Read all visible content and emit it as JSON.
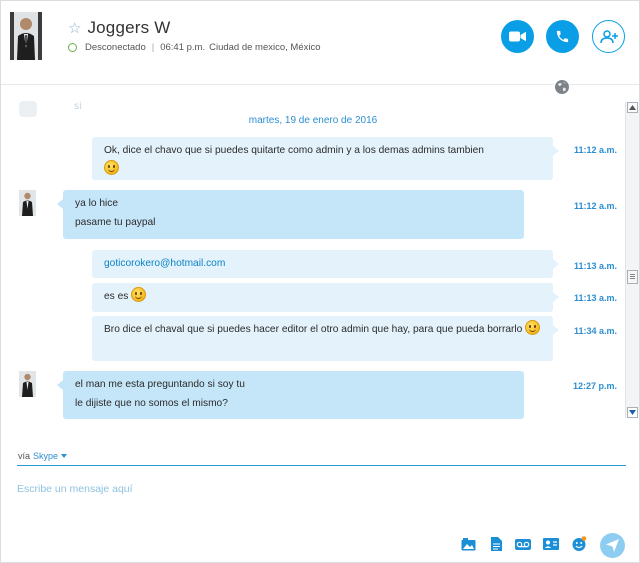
{
  "contact": {
    "name": "Joggers W",
    "status": "Desconectado",
    "local_time": "06:41 p.m.",
    "location": "Ciudad de mexico, México"
  },
  "colors": {
    "accent": "#0a9ee6",
    "bubble_sent": "#e3f2fb",
    "bubble_received": "#c5e6f9",
    "time": "#2d8fd0"
  },
  "header_buttons": [
    {
      "name": "video-call-button",
      "icon": "video-camera-icon"
    },
    {
      "name": "voice-call-button",
      "icon": "phone-icon"
    },
    {
      "name": "add-participant-button",
      "icon": "add-person-icon"
    }
  ],
  "conversation": {
    "ghost_text": "si",
    "date": "martes, 19 de enero de 2016",
    "messages": [
      {
        "from": "me",
        "text": "Ok, dice el chavo que si puedes quitarte como admin y a los demas admins tambien",
        "emoji": "smile",
        "time": "11:12 a.m."
      },
      {
        "from": "them",
        "text": "ya lo hice",
        "time": "11:12 a.m."
      },
      {
        "from": "them",
        "text": "pasame tu paypal"
      },
      {
        "from": "me",
        "text": "goticorokero@hotmail.com",
        "link": true,
        "time": "11:13 a.m."
      },
      {
        "from": "me",
        "text": "es es",
        "emoji": "smile",
        "time": "11:13 a.m."
      },
      {
        "from": "me",
        "text": "Bro dice el chaval que si puedes hacer editor el otro admin que hay, para que pueda borrarlo",
        "emoji": "smile",
        "time": "11:34 a.m."
      },
      {
        "from": "them",
        "text": "el man me esta preguntando si soy tu",
        "time": "12:27 p.m."
      },
      {
        "from": "them",
        "text": "le dijiste que no somos el mismo?"
      }
    ]
  },
  "compose": {
    "via_label": "vía",
    "via_service": "Skype",
    "placeholder": "Escribe un mensaje aquí"
  },
  "toolbar": [
    {
      "name": "send-photo-button",
      "icon": "image-icon"
    },
    {
      "name": "send-file-button",
      "icon": "file-icon"
    },
    {
      "name": "video-message-button",
      "icon": "voicemail-icon"
    },
    {
      "name": "send-contact-button",
      "icon": "contact-card-icon"
    },
    {
      "name": "emoticon-button",
      "icon": "emoticon-icon"
    },
    {
      "name": "send-button",
      "icon": "send-icon"
    }
  ]
}
